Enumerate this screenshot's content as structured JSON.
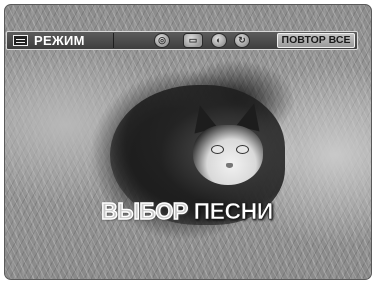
{
  "toolbar": {
    "mode_label": "РЕЖИМ",
    "repeat_all_label": "ПОВТОР ВСЕ",
    "icons": [
      "disc-icon",
      "playlist-icon",
      "chapter-icon",
      "repeat-icon"
    ]
  },
  "caption": {
    "word1": "ВЫБОР",
    "word2": "ПЕСНИ"
  }
}
